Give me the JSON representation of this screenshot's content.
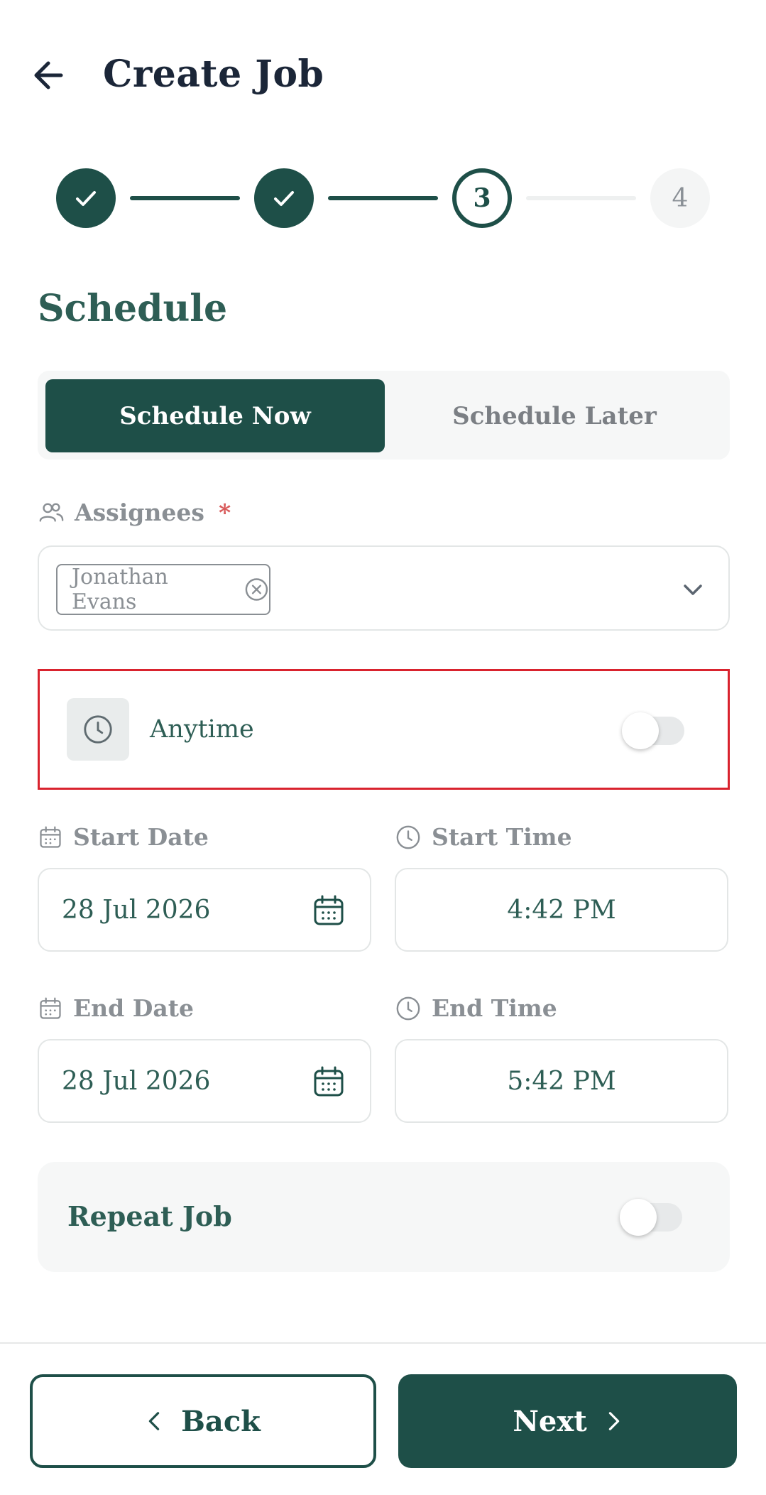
{
  "header": {
    "title": "Create Job",
    "back_icon": "arrow-left-icon"
  },
  "stepper": {
    "steps": [
      {
        "label": "",
        "state": "completed"
      },
      {
        "label": "",
        "state": "completed"
      },
      {
        "label": "3",
        "state": "current"
      },
      {
        "label": "4",
        "state": "upcoming"
      }
    ]
  },
  "section": {
    "title": "Schedule"
  },
  "schedule_mode": {
    "options": [
      "Schedule Now",
      "Schedule Later"
    ],
    "selected": "Schedule Now"
  },
  "assignees": {
    "label": "Assignees",
    "required_mark": "*",
    "selected": [
      "Jonathan Evans"
    ]
  },
  "anytime": {
    "label": "Anytime",
    "enabled": false
  },
  "start": {
    "date_label": "Start Date",
    "date_value": "28 Jul 2026",
    "time_label": "Start Time",
    "time_value": "4:42 PM"
  },
  "end": {
    "date_label": "End Date",
    "date_value": "28 Jul 2026",
    "time_label": "End Time",
    "time_value": "5:42 PM"
  },
  "repeat": {
    "label": "Repeat Job",
    "enabled": false
  },
  "footer": {
    "back_label": "Back",
    "next_label": "Next"
  },
  "colors": {
    "primary": "#1e4f48",
    "title_text": "#1b2638",
    "muted": "#8a8f94",
    "required": "#d85a5a",
    "highlight_border": "#d9232e"
  }
}
